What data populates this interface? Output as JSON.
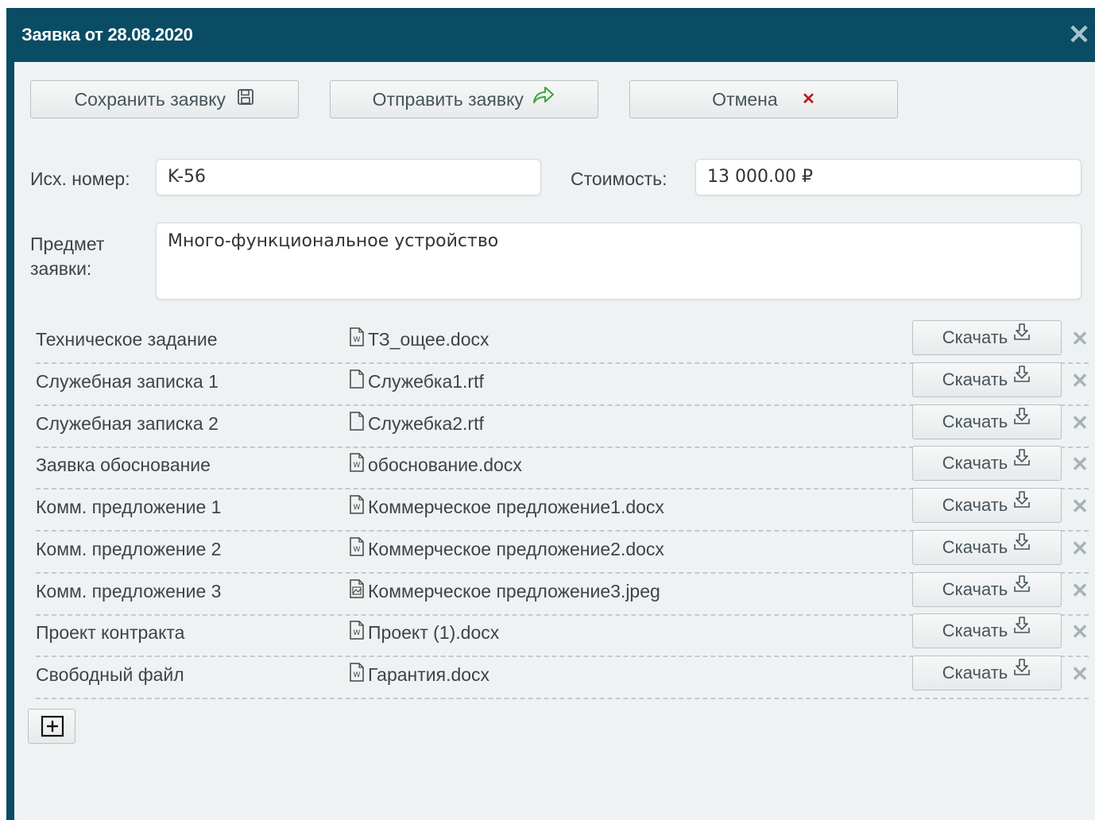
{
  "dialog": {
    "title": "Заявка от 28.08.2020",
    "close_glyph": "✕"
  },
  "toolbar": {
    "save_label": "Сохранить заявку",
    "save_icon": "floppy-icon",
    "send_label": "Отправить заявку",
    "send_icon": "share-arrow-icon",
    "cancel_label": "Отмена",
    "cancel_icon": "cancel-x-icon",
    "cancel_glyph": "✕",
    "colors": {
      "send_icon": "#3aa63a",
      "cancel_icon": "#c0161d"
    }
  },
  "form": {
    "number_label": "Исх. номер:",
    "number_value": "K-56",
    "cost_label": "Стоимость:",
    "cost_value": "13 000.00 ₽",
    "subject_label_line1": "Предмет",
    "subject_label_line2": "заявки:",
    "subject_value": "Много-функциональное устройство"
  },
  "files": [
    {
      "label": "Техническое задание",
      "file": "ТЗ_ощее.docx",
      "icon": "word-file-icon",
      "download": "Скачать",
      "delete": "✕"
    },
    {
      "label": "Служебная записка 1",
      "file": "Служебка1.rtf",
      "icon": "blank-file-icon",
      "download": "Скачать",
      "delete": "✕"
    },
    {
      "label": "Служебная записка 2",
      "file": "Служебка2.rtf",
      "icon": "blank-file-icon",
      "download": "Скачать",
      "delete": "✕"
    },
    {
      "label": "Заявка обоснование",
      "file": "обоснование.docx",
      "icon": "word-file-icon",
      "download": "Скачать",
      "delete": "✕"
    },
    {
      "label": "Комм. предложение 1",
      "file": "Коммерческое предложение1.docx",
      "icon": "word-file-icon",
      "download": "Скачать",
      "delete": "✕"
    },
    {
      "label": "Комм. предложение 2",
      "file": "Коммерческое предложение2.docx",
      "icon": "word-file-icon",
      "download": "Скачать",
      "delete": "✕"
    },
    {
      "label": "Комм. предложение 3",
      "file": "Коммерческое предложение3.jpeg",
      "icon": "image-file-icon",
      "download": "Скачать",
      "delete": "✕"
    },
    {
      "label": "Проект контракта",
      "file": "Проект (1).docx",
      "icon": "word-file-icon",
      "download": "Скачать",
      "delete": "✕"
    },
    {
      "label": "Свободный файл",
      "file": "Гарантия.docx",
      "icon": "word-file-icon",
      "download": "Скачать",
      "delete": "✕"
    }
  ],
  "add_button_icon": "plus-box-icon",
  "colors": {
    "titlebar": "#094c63",
    "body_bg": "#eef2f3"
  }
}
